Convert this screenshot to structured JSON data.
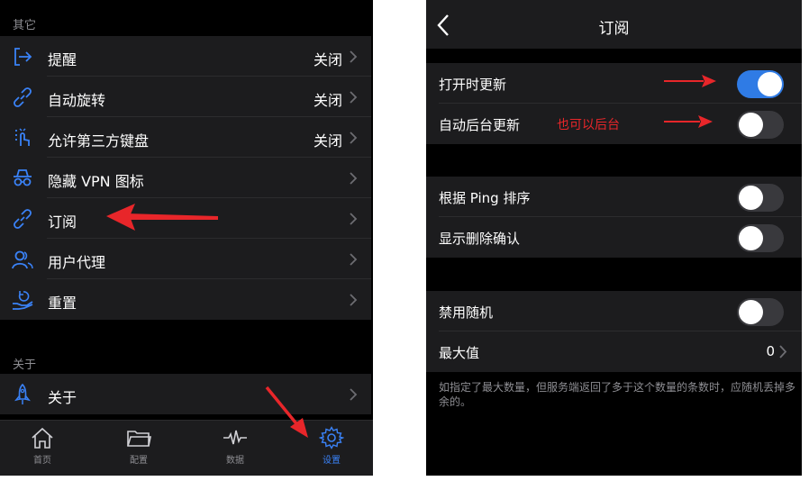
{
  "left": {
    "section_other": "其它",
    "section_about": "关于",
    "items": [
      {
        "label": "提醒",
        "value": "关闭",
        "icon": "exit-arrow-icon"
      },
      {
        "label": "自动旋转",
        "value": "关闭",
        "icon": "link-icon"
      },
      {
        "label": "允许第三方键盘",
        "value": "关闭",
        "icon": "tap-gesture-icon"
      },
      {
        "label": "隐藏 VPN 图标",
        "value": "",
        "icon": "incognito-icon"
      },
      {
        "label": "订阅",
        "value": "",
        "icon": "link-icon"
      },
      {
        "label": "用户代理",
        "value": "",
        "icon": "users-icon"
      },
      {
        "label": "重置",
        "value": "",
        "icon": "hand-reset-icon"
      }
    ],
    "about_item": {
      "label": "关于",
      "icon": "rocket-icon"
    },
    "tabs": [
      {
        "label": "首页",
        "icon": "home-icon",
        "active": false
      },
      {
        "label": "配置",
        "icon": "folder-icon",
        "active": false
      },
      {
        "label": "数据",
        "icon": "pulse-icon",
        "active": false
      },
      {
        "label": "设置",
        "icon": "gear-icon",
        "active": true
      }
    ]
  },
  "right": {
    "title": "订阅",
    "group1": [
      {
        "label": "打开时更新",
        "on": true
      },
      {
        "label": "自动后台更新",
        "on": false
      }
    ],
    "group2": [
      {
        "label": "根据 Ping 排序",
        "on": false
      },
      {
        "label": "显示删除确认",
        "on": false
      }
    ],
    "group3": {
      "disable_random": {
        "label": "禁用随机",
        "on": false
      },
      "max_value": {
        "label": "最大值",
        "value": "0"
      }
    },
    "footnote": "如指定了最大数量，但服务端返回了多于这个数量的条数时，应随机丢掉多余的。"
  },
  "annotation": {
    "note": "也可以后台",
    "color": "#e8262a"
  },
  "colors": {
    "accent": "#3a82f7",
    "toggle_on": "#2f7be5",
    "cell_bg": "#1c1c1e",
    "page_bg": "#000000"
  }
}
